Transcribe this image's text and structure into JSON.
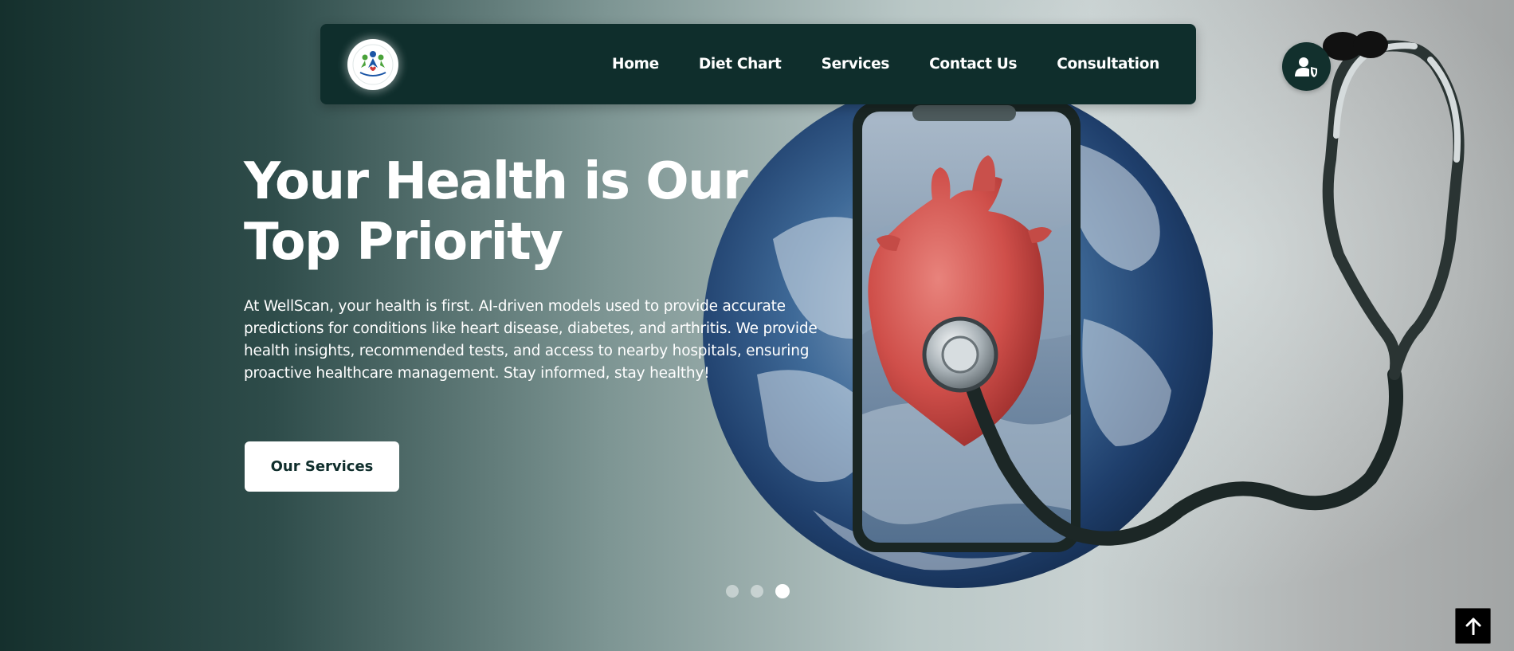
{
  "nav": {
    "logo_icon": "wellscan-logo-icon",
    "links": [
      "Home",
      "Diet Chart",
      "Services",
      "Contact Us",
      "Consultation"
    ],
    "account_icon": "user-shield-icon"
  },
  "hero": {
    "title": "Your Health is Our Top Priority",
    "description": "At WellScan, your health is first. AI-driven models used to provide accurate predictions for conditions like heart disease, diabetes, and arthritis. We provide health insights, recommended tests, and access to nearby hospitals, ensuring proactive healthcare management. Stay informed, stay healthy!",
    "cta_label": "Our Services"
  },
  "carousel": {
    "slide_count": 3,
    "active_slide": 3
  },
  "scroll_top_icon": "arrow-up-icon",
  "colors": {
    "brand_dark": "#0f2e2c",
    "accent_white": "#ffffff"
  }
}
